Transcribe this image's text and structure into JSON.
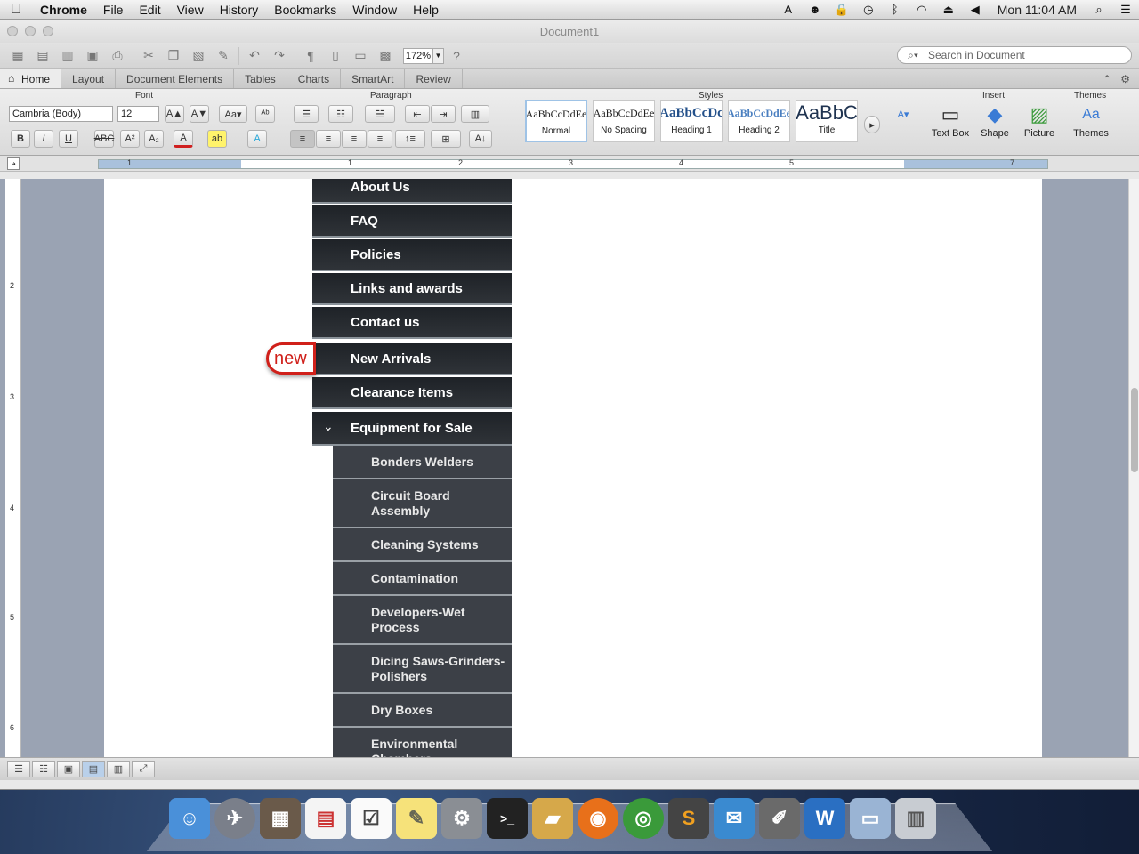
{
  "menubar": {
    "app": "Chrome",
    "items": [
      "File",
      "Edit",
      "View",
      "History",
      "Bookmarks",
      "Window",
      "Help"
    ],
    "clock": "Mon 11:04 AM"
  },
  "window": {
    "title": "Document1"
  },
  "toolbar": {
    "zoom": "172%",
    "search_placeholder": "Search in Document"
  },
  "tabs": [
    "Home",
    "Layout",
    "Document Elements",
    "Tables",
    "Charts",
    "SmartArt",
    "Review"
  ],
  "ribbon": {
    "font_title": "Font",
    "paragraph_title": "Paragraph",
    "styles_title": "Styles",
    "insert_title": "Insert",
    "themes_title": "Themes",
    "font_name": "Cambria (Body)",
    "font_size": "12",
    "styles": [
      {
        "preview": "AaBbCcDdEe",
        "name": "Normal"
      },
      {
        "preview": "AaBbCcDdEe",
        "name": "No Spacing"
      },
      {
        "preview": "AaBbCcDc",
        "name": "Heading 1"
      },
      {
        "preview": "AaBbCcDdEe",
        "name": "Heading 2"
      },
      {
        "preview": "AaBbC",
        "name": "Title"
      }
    ],
    "insert": [
      "Text Box",
      "Shape",
      "Picture"
    ],
    "themes_label": "Themes"
  },
  "ruler": {
    "numbers": [
      "1",
      "1",
      "2",
      "3",
      "4",
      "5",
      "7"
    ]
  },
  "vruler": {
    "numbers": [
      "2",
      "3",
      "4",
      "5",
      "6"
    ]
  },
  "menu": {
    "badge": "new",
    "items": [
      "About Us",
      "FAQ",
      "Policies",
      "Links and awards",
      "Contact us",
      "New Arrivals",
      "Clearance Items",
      "Equipment for Sale"
    ],
    "subitems": [
      "Bonders Welders",
      "Circuit Board Assembly",
      "Cleaning Systems",
      "Contamination",
      "Developers-Wet Process",
      "Dicing Saws-Grinders-Polishers",
      "Dry Boxes",
      "Environmental Chambers"
    ]
  },
  "colors": {
    "menu_bg": "#24282d",
    "submenu_bg": "#3c4047",
    "badge": "#d0201a",
    "accent": "#9fc3e6"
  }
}
